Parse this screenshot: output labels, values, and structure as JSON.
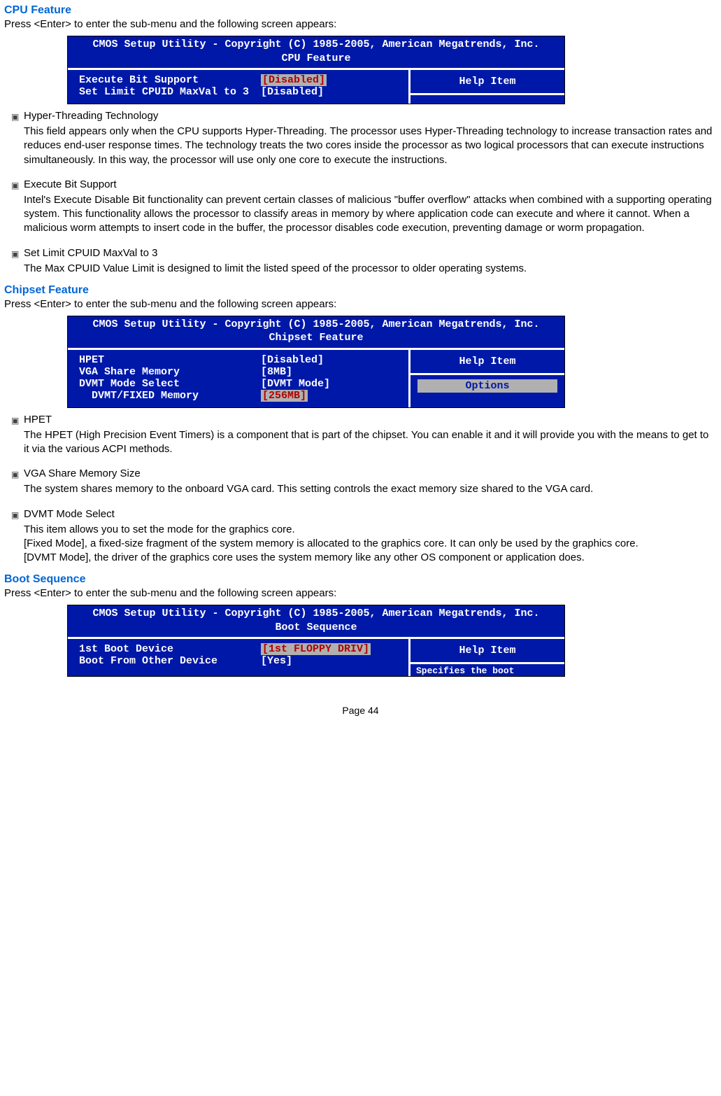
{
  "sections": {
    "cpu": {
      "title": "CPU Feature",
      "intro": "Press <Enter> to enter the sub-menu and the following screen appears:",
      "bios": {
        "header1": "CMOS Setup Utility - Copyright (C) 1985-2005, American Megatrends, Inc.",
        "header2": "CPU Feature",
        "rows": [
          {
            "label": "Execute Bit Support",
            "value": "[Disabled]",
            "selected": true
          },
          {
            "label": "Set Limit CPUID MaxVal to 3",
            "value": "[Disabled]",
            "selected": false
          }
        ],
        "help": "Help Item",
        "truncated": ""
      },
      "bullets": [
        {
          "title": "Hyper-Threading Technology",
          "text": "This field appears only when the CPU supports Hyper-Threading. The processor uses Hyper-Threading technology to increase transaction rates and reduces end-user response times. The technology treats the two cores inside the processor as two logical processors that can execute instructions simultaneously. In this way, the processor will use only one core to execute the instructions."
        },
        {
          "title": "Execute Bit Support",
          "text": "Intel's Execute Disable Bit functionality can prevent certain classes of malicious \"buffer overflow\" attacks when combined with a supporting operating system. This functionality allows the processor to classify areas in memory by where application code can execute and where it cannot. When a malicious worm attempts to insert code in the buffer, the processor disables code execution, preventing damage or worm propagation."
        },
        {
          "title": "Set Limit CPUID MaxVal to 3",
          "text": "The Max CPUID Value Limit is designed to limit the listed speed of the processor to older operating systems."
        }
      ]
    },
    "chipset": {
      "title": "Chipset Feature",
      "intro": "Press <Enter> to enter the sub-menu and the following screen appears:",
      "bios": {
        "header1": "CMOS Setup Utility - Copyright (C) 1985-2005, American Megatrends, Inc.",
        "header2": "Chipset Feature",
        "rows": [
          {
            "label": "HPET",
            "value": "[Disabled]",
            "selected": false
          },
          {
            "label": "VGA Share Memory",
            "value": "[8MB]",
            "selected": false
          },
          {
            "label": "DVMT Mode Select",
            "value": "[DVMT Mode]",
            "selected": false
          },
          {
            "label": "  DVMT/FIXED Memory",
            "value": "[256MB]",
            "selected": true
          }
        ],
        "help": "Help Item",
        "options": "Options"
      },
      "bullets": [
        {
          "title": "HPET",
          "text": "The HPET (High Precision Event Timers) is a component that is part of the chipset. You can enable it and it will provide you with the means to get to it via the various ACPI methods."
        },
        {
          "title": "VGA Share Memory Size",
          "text": "The system shares memory to the onboard VGA card. This setting controls the exact memory size shared to the VGA card."
        },
        {
          "title": "DVMT Mode Select",
          "text": "This item allows you to set the mode for the graphics core.\n[Fixed Mode], a fixed-size fragment of the system memory is allocated to the graphics core. It can only be used by the graphics core.\n[DVMT Mode], the driver of the graphics core uses the system memory like any other OS component or application does."
        }
      ]
    },
    "boot": {
      "title": "Boot Sequence",
      "intro": "Press <Enter> to enter the sub-menu and the following screen appears:",
      "bios": {
        "header1": "CMOS Setup Utility - Copyright (C) 1985-2005, American Megatrends, Inc.",
        "header2": "Boot Sequence",
        "rows": [
          {
            "label": "1st Boot Device",
            "value": "[1st FLOPPY DRIV]",
            "selected": true
          },
          {
            "label": "Boot From Other Device",
            "value": "[Yes]",
            "selected": false
          }
        ],
        "help": "Help Item",
        "truncated": "Specifies the boot"
      }
    }
  },
  "footer": "Page 44"
}
